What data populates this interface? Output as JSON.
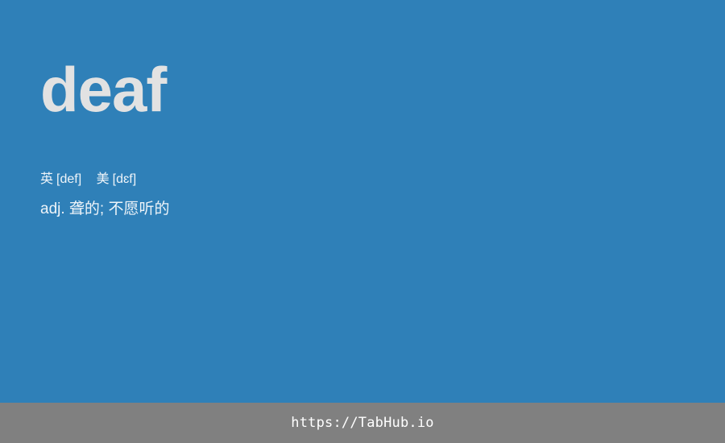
{
  "card": {
    "word": "deaf",
    "phonetics": [
      {
        "region": "英",
        "ipa": "[def]"
      },
      {
        "region": "美",
        "ipa": "[dɛf]"
      }
    ],
    "definition": "adj. 聋的; 不愿听的"
  },
  "footer": {
    "url": "https://TabHub.io"
  },
  "colors": {
    "background": "#2f80b8",
    "word": "#e2e2e2",
    "text": "#eef4f9",
    "footer": "#808080"
  }
}
